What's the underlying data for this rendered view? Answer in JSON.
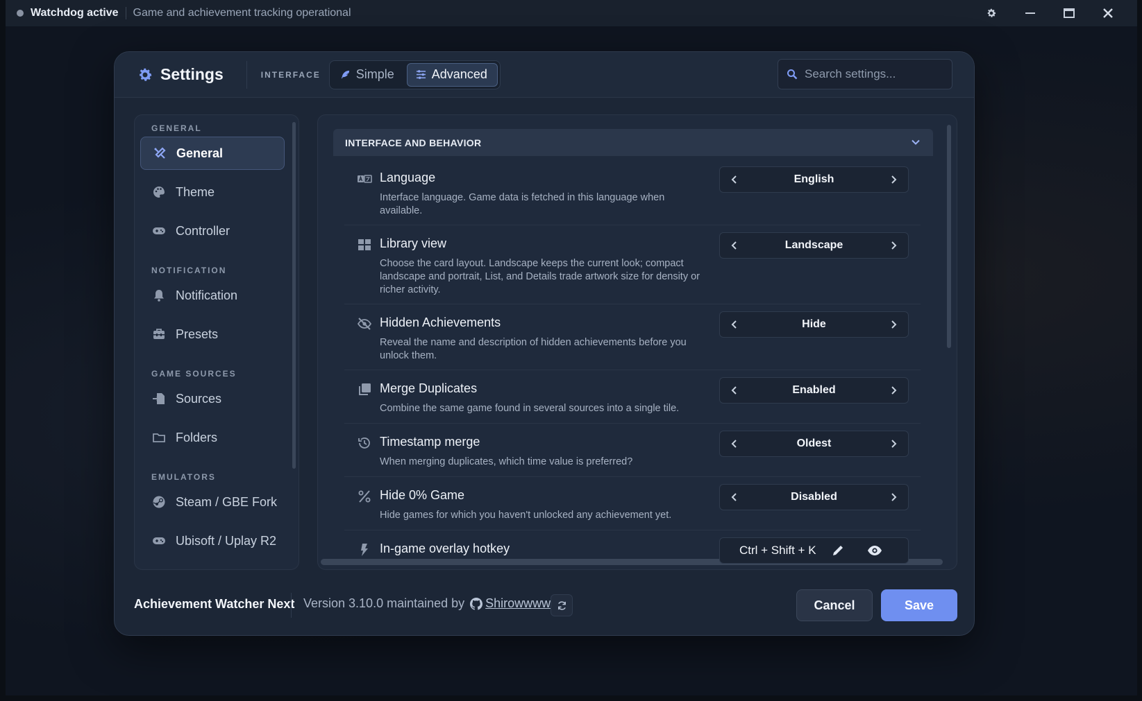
{
  "titlebar": {
    "status": "Watchdog active",
    "subtitle": "Game and achievement tracking operational"
  },
  "header": {
    "title": "Settings",
    "interface_label": "INTERFACE",
    "modes": [
      {
        "label": "Simple",
        "active": false
      },
      {
        "label": "Advanced",
        "active": true
      }
    ],
    "search_placeholder": "Search settings..."
  },
  "sidebar": {
    "sections": [
      {
        "title": "GENERAL",
        "items": [
          {
            "label": "General",
            "icon": "tools-icon",
            "active": true
          },
          {
            "label": "Theme",
            "icon": "palette-icon"
          },
          {
            "label": "Controller",
            "icon": "gamepad-icon"
          }
        ]
      },
      {
        "title": "NOTIFICATION",
        "items": [
          {
            "label": "Notification",
            "icon": "bell-icon"
          },
          {
            "label": "Presets",
            "icon": "toolbox-icon"
          }
        ]
      },
      {
        "title": "GAME SOURCES",
        "items": [
          {
            "label": "Sources",
            "icon": "file-import-icon"
          },
          {
            "label": "Folders",
            "icon": "folder-icon"
          }
        ]
      },
      {
        "title": "EMULATORS",
        "items": [
          {
            "label": "Steam / GBE Fork",
            "icon": "steam-icon"
          },
          {
            "label": "Ubisoft / Uplay R2",
            "icon": "gamepad-icon"
          }
        ]
      }
    ]
  },
  "main": {
    "section_title": "INTERFACE AND BEHAVIOR",
    "settings": [
      {
        "title": "Language",
        "icon": "language-icon",
        "description": "Interface language. Game data is fetched in this language when available.",
        "value": "English"
      },
      {
        "title": "Library view",
        "icon": "grid-icon",
        "description": "Choose the card layout. Landscape keeps the current look; compact landscape and portrait, List, and Details trade artwork size for density or richer activity.",
        "value": "Landscape"
      },
      {
        "title": "Hidden Achievements",
        "icon": "eye-slash-icon",
        "description": "Reveal the name and description of hidden achievements before you unlock them.",
        "value": "Hide"
      },
      {
        "title": "Merge Duplicates",
        "icon": "clone-icon",
        "description": "Combine the same game found in several sources into a single tile.",
        "value": "Enabled"
      },
      {
        "title": "Timestamp merge",
        "icon": "history-icon",
        "description": "When merging duplicates, which time value is preferred?",
        "value": "Oldest"
      },
      {
        "title": "Hide 0% Game",
        "icon": "percent-icon",
        "description": "Hide games for which you haven't unlocked any achievement yet.",
        "value": "Disabled"
      }
    ],
    "hotkey": {
      "title": "In-game overlay hotkey",
      "icon": "bolt-icon",
      "value": "Ctrl + Shift + K"
    }
  },
  "footer": {
    "app_name": "Achievement Watcher Next",
    "version_text": "Version 3.10.0 maintained by",
    "author": "Shirowwww",
    "cancel_label": "Cancel",
    "save_label": "Save"
  },
  "colors": {
    "accent": "#6f8ff0",
    "background": "#0f1520",
    "panel": "#1f2a3c"
  }
}
